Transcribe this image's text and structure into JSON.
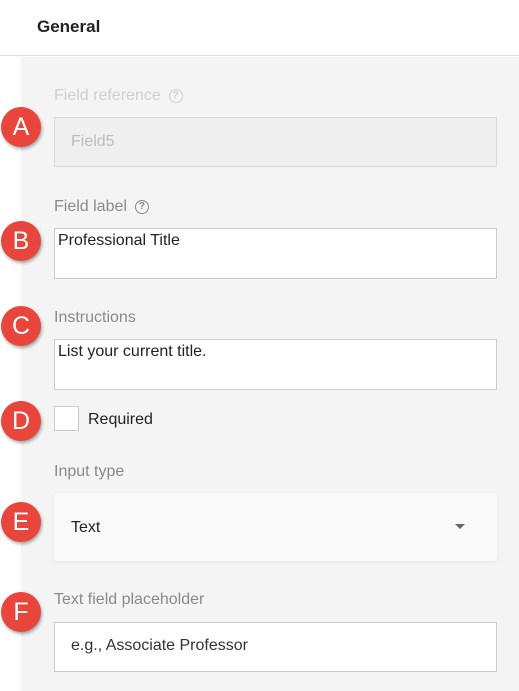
{
  "header": {
    "title": "General"
  },
  "fields": {
    "reference": {
      "label": "Field reference",
      "value": "Field5"
    },
    "label": {
      "label": "Field label",
      "value": "Professional Title"
    },
    "instructions": {
      "label": "Instructions",
      "value": "List your current title."
    },
    "required": {
      "label": "Required",
      "checked": false
    },
    "input_type": {
      "label": "Input type",
      "selected": "Text"
    },
    "placeholder": {
      "label": "Text field placeholder",
      "value": "e.g., Associate Professor"
    }
  },
  "markers": [
    "A",
    "B",
    "C",
    "D",
    "E",
    "F"
  ],
  "icons": {
    "help": "help-icon",
    "caret": "chevron-down-icon"
  },
  "colors": {
    "marker": "#e8453c"
  }
}
